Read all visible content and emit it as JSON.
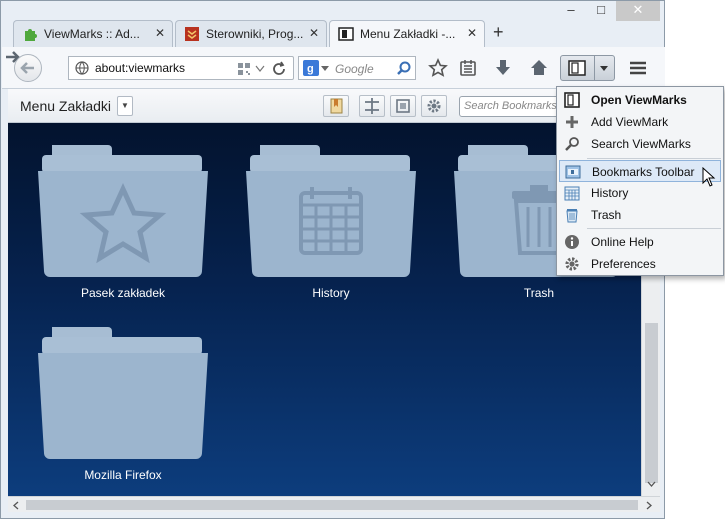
{
  "window": {
    "caption": {
      "minimize": "–",
      "maximize": "□",
      "close": "✕"
    }
  },
  "tabs": [
    {
      "label": "ViewMarks :: Ad...",
      "icon": "puzzle-icon",
      "active": false
    },
    {
      "label": "Sterowniki, Prog...",
      "icon": "site-favicon",
      "active": false
    },
    {
      "label": "Menu Zakładki -...",
      "icon": "viewmarks-icon",
      "active": true
    }
  ],
  "new_tab_label": "+",
  "navbar": {
    "url": "about:viewmarks",
    "search_engine": "Google",
    "search_placeholder": "Google"
  },
  "viewmarks": {
    "title": "Menu Zakładki",
    "search_placeholder": "Search Bookmarks"
  },
  "folders": [
    {
      "label": "Pasek zakładek",
      "icon": "star-icon"
    },
    {
      "label": "History",
      "icon": "calendar-icon"
    },
    {
      "label": "Trash",
      "icon": "trash-icon"
    },
    {
      "label": "Mozilla Firefox",
      "icon": "none"
    }
  ],
  "menu": {
    "items": [
      {
        "label": "Open ViewMarks",
        "icon": "viewmarks-icon",
        "bold": true
      },
      {
        "label": "Add ViewMark",
        "icon": "plus-icon",
        "bold": false
      },
      {
        "label": "Search ViewMarks",
        "icon": "magnifier-icon",
        "bold": false
      },
      {
        "label": "Bookmarks Toolbar",
        "icon": "toolbar-icon",
        "bold": false,
        "highlighted": true
      },
      {
        "label": "History",
        "icon": "calendar-icon",
        "bold": false
      },
      {
        "label": "Trash",
        "icon": "trash-icon",
        "bold": false
      },
      {
        "label": "Online Help",
        "icon": "info-icon",
        "bold": false
      },
      {
        "label": "Preferences",
        "icon": "gear-icon",
        "bold": false
      }
    ]
  },
  "colors": {
    "canvas_top": "#03132e",
    "canvas_bottom": "#0d3d7d",
    "folder": "#9fb7d0",
    "menu_highlight": "#dde9f7"
  }
}
